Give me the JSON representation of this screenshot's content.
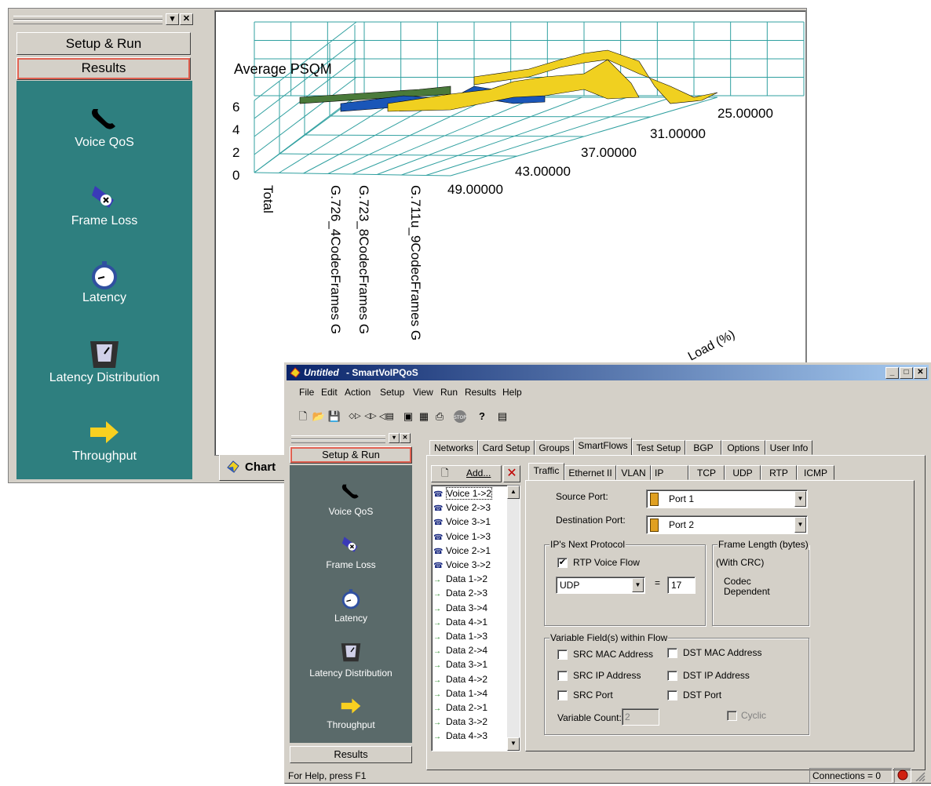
{
  "bg_window": {
    "nav": {
      "setup_run": "Setup & Run",
      "results": "Results",
      "items": [
        {
          "label": "Voice QoS",
          "icon": "phone-icon"
        },
        {
          "label": "Frame Loss",
          "icon": "frame-loss-icon"
        },
        {
          "label": "Latency",
          "icon": "stopwatch-icon"
        },
        {
          "label": "Latency Distribution",
          "icon": "bucket-gauge-icon"
        },
        {
          "label": "Throughput",
          "icon": "arrow-right-icon"
        }
      ]
    },
    "chart_tab_label": "Chart"
  },
  "chart_data": {
    "type": "3d-surface",
    "title": "Average PSQM",
    "xlabel": "Load (%)",
    "z_ticks": [
      "6",
      "4",
      "2",
      "0"
    ],
    "z_range": [
      0,
      6
    ],
    "categories": [
      "Total",
      "G.726_4CodecFrames G",
      "G.723_8CodecFrames G",
      "G.711u_9CodecFrames G"
    ],
    "load_ticks": [
      "25.00000",
      "31.00000",
      "37.00000",
      "43.00000",
      "49.00000"
    ],
    "series": [
      {
        "name": "Total",
        "color": "#4a7a3a"
      },
      {
        "name": "G.726_4CodecFrames",
        "color": "#1a56b8"
      },
      {
        "name": "G.723_8CodecFrames",
        "color": "#f0d020"
      },
      {
        "name": "G.711u_9CodecFrames",
        "color": "#f0d020"
      }
    ]
  },
  "fg_window": {
    "title_italic": "Untitled",
    "title_rest": " - SmartVoIPQoS",
    "menu": [
      "File",
      "Edit",
      "Action",
      "Setup",
      "View",
      "Run",
      "Results",
      "Help"
    ],
    "nav": {
      "setup_run": "Setup & Run",
      "results": "Results",
      "items": [
        "Voice QoS",
        "Frame Loss",
        "Latency",
        "Latency Distribution",
        "Throughput"
      ]
    },
    "main_tabs": [
      "Networks",
      "Card Setup",
      "Groups",
      "SmartFlows",
      "Test Setup",
      "BGP",
      "Options",
      "User Info"
    ],
    "sub_tabs": [
      "Traffic",
      "Ethernet II",
      "VLAN",
      "IP",
      "TCP",
      "UDP",
      "RTP",
      "ICMP"
    ],
    "add_button": "Add...",
    "flows": [
      "Voice 1->2",
      "Voice 2->3",
      "Voice 3->1",
      "Voice 1->3",
      "Voice 2->1",
      "Voice 3->2",
      "Data 1->2",
      "Data 2->3",
      "Data 3->4",
      "Data 4->1",
      "Data 1->3",
      "Data 2->4",
      "Data 3->1",
      "Data 4->2",
      "Data 1->4",
      "Data 2->1",
      "Data 3->2",
      "Data 4->3"
    ],
    "traffic": {
      "source_port_label": "Source Port:",
      "source_port_value": "Port 1",
      "dest_port_label": "Destination Port:",
      "dest_port_value": "Port 2",
      "next_protocol_group": "IP's Next Protocol",
      "rtp_voice_flow": "RTP Voice Flow",
      "rtp_checked": true,
      "protocol_value": "UDP",
      "equals": "=",
      "protocol_number": "17",
      "frame_length_group": "Frame Length (bytes)",
      "with_crc": "(With CRC)",
      "codec_dependent": "Codec\nDependent",
      "variable_group": "Variable Field(s) within Flow",
      "src_mac": "SRC MAC Address",
      "dst_mac": "DST MAC Address",
      "src_ip": "SRC IP Address",
      "dst_ip": "DST IP Address",
      "src_port": "SRC Port",
      "dst_port": "DST Port",
      "variable_count_label": "Variable Count:",
      "variable_count_value": "2",
      "cyclic": "Cyclic"
    },
    "status": {
      "help": "For Help, press F1",
      "connections": "Connections = 0"
    }
  }
}
